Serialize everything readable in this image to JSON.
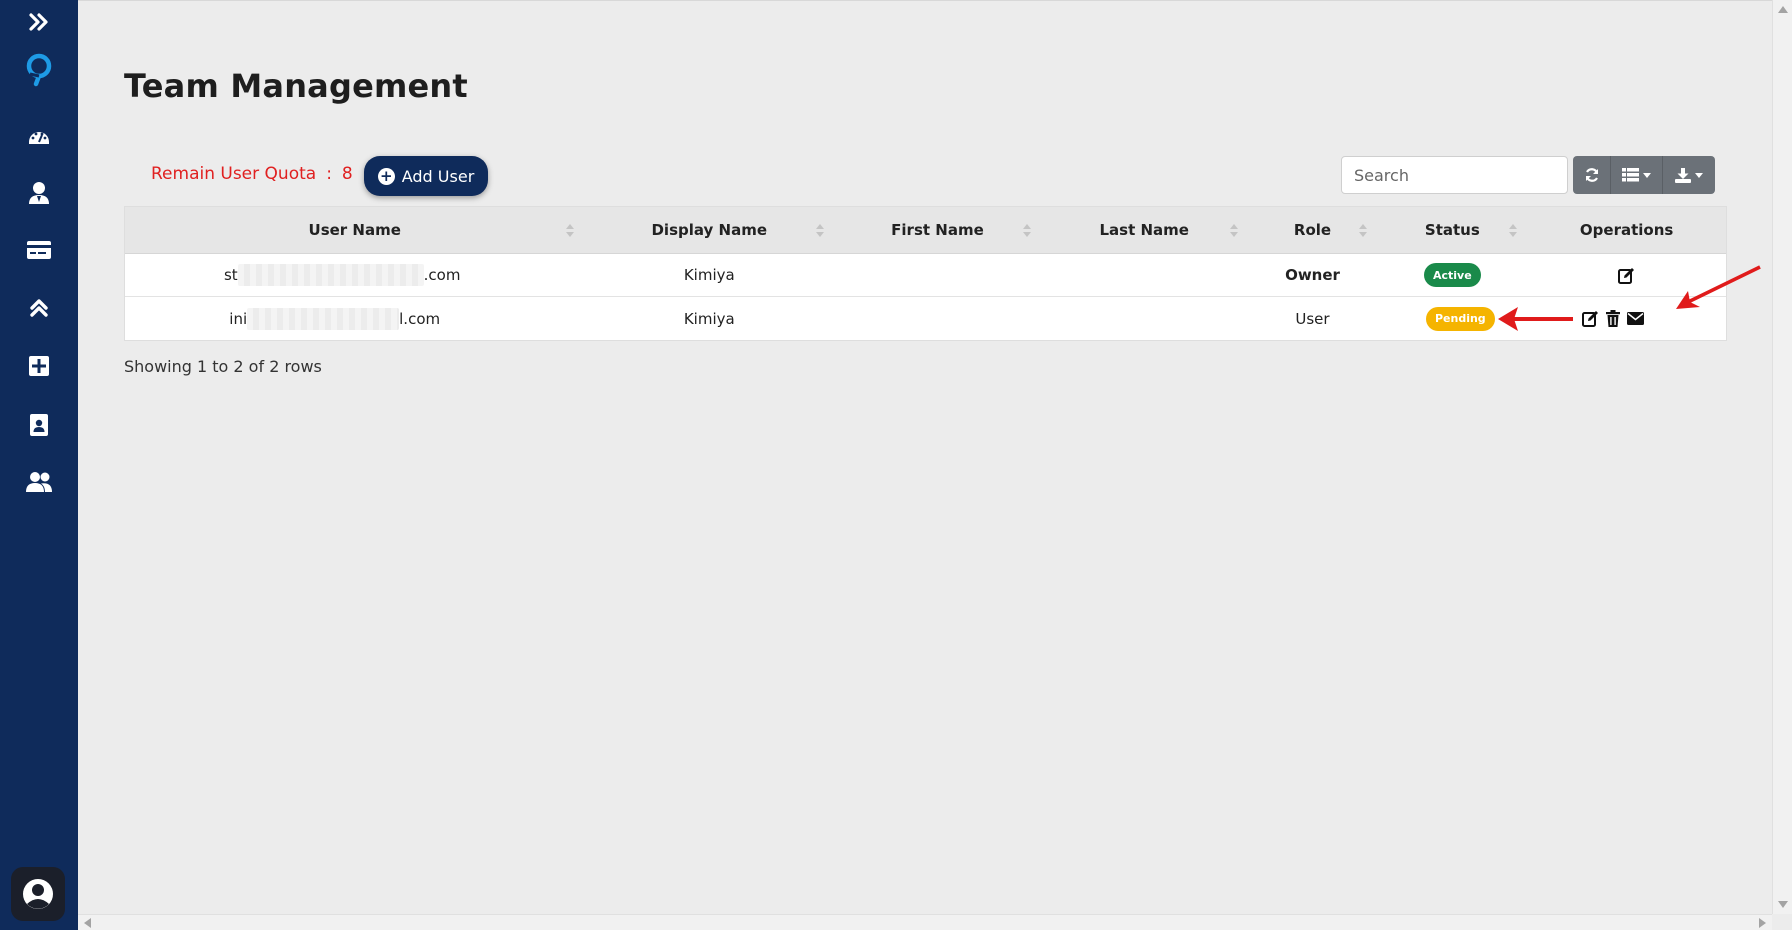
{
  "sidebar": {
    "items": [
      {
        "icon": "double-chevron-right-icon"
      },
      {
        "icon": "logo-icon"
      },
      {
        "icon": "dashboard-gauge-icon"
      },
      {
        "icon": "user-icon"
      },
      {
        "icon": "credit-card-icon"
      },
      {
        "icon": "double-chevron-up-icon"
      },
      {
        "icon": "grid-plus-icon"
      },
      {
        "icon": "contact-card-icon"
      },
      {
        "icon": "users-group-icon"
      }
    ],
    "avatar_icon": "user-circle-icon"
  },
  "page": {
    "title": "Team Management"
  },
  "quota": {
    "label": "Remain User Quota",
    "separator": ":",
    "value": "8"
  },
  "add_user": {
    "label": "Add User"
  },
  "search": {
    "placeholder": "Search"
  },
  "toolbar": {
    "buttons": [
      "refresh-icon",
      "columns-list-icon",
      "export-download-icon"
    ]
  },
  "table": {
    "columns": [
      "User Name",
      "Display Name",
      "First Name",
      "Last Name",
      "Role",
      "Status",
      "Operations"
    ],
    "rows": [
      {
        "user_prefix": "st",
        "user_suffix": ".com",
        "display_name": "Kimiya",
        "first_name": "",
        "last_name": "",
        "role": "Owner",
        "status": "Active",
        "operations": [
          "edit-icon"
        ]
      },
      {
        "user_prefix": "ini",
        "user_suffix": "l.com",
        "display_name": "Kimiya",
        "first_name": "",
        "last_name": "",
        "role": "User",
        "status": "Pending",
        "operations": [
          "edit-icon",
          "trash-icon",
          "envelope-icon"
        ]
      }
    ]
  },
  "footer": {
    "summary": "Showing 1 to 2 of 2 rows"
  },
  "colors": {
    "sidebar_bg": "#0f2b5b",
    "accent": "#0f2b5b",
    "quota_text": "#e02020",
    "active_badge": "#1a8a4a",
    "pending_badge": "#f5b400",
    "annotation_arrow": "#e01b1b"
  }
}
